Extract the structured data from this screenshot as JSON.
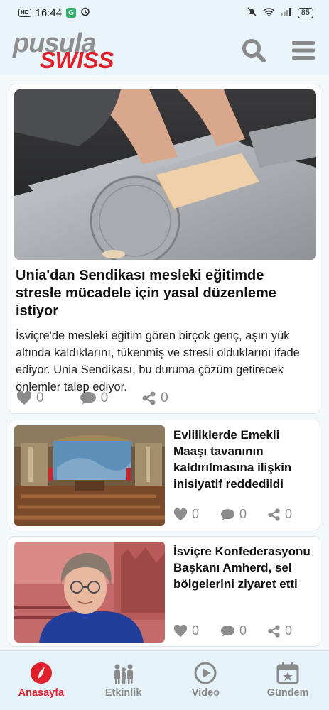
{
  "status_bar": {
    "hd": "HD",
    "time": "16:44",
    "g_badge": "G",
    "battery": "85"
  },
  "brand": {
    "logo_top": "pusula",
    "logo_bottom": "SWISS",
    "accent": "#e0202a",
    "gray": "#8e8e8e"
  },
  "header": {
    "search_icon": "search-icon",
    "menu_icon": "hamburger-menu-icon"
  },
  "articles": [
    {
      "title": "Unia'dan Sendikası mesleki eğitimde stresle mücadele için yasal düzenleme istiyor",
      "summary": "İsviçre'de mesleki eğitim gören birçok genç, aşırı yük altında kaldıklarını, tükenmiş ve stresli olduklarını ifade ediyor. Unia Sendikası, bu duruma çözüm getirecek önlemler talep ediyor.",
      "likes": "0",
      "comments": "0",
      "shares": "0"
    },
    {
      "title": "Evliliklerde Emekli Maaşı tavanının kaldırılmasına ilişkin inisiyatif reddedildi",
      "likes": "0",
      "comments": "0",
      "shares": "0"
    },
    {
      "title": "İsviçre Konfederasyonu Başkanı Amherd, sel bölgelerini ziyaret etti",
      "likes": "0",
      "comments": "0",
      "shares": "0"
    }
  ],
  "bottom_nav": [
    {
      "label": "Anasayfa",
      "icon": "compass-icon",
      "active": true
    },
    {
      "label": "Etkinlik",
      "icon": "people-icon",
      "active": false
    },
    {
      "label": "Video",
      "icon": "play-circle-icon",
      "active": false
    },
    {
      "label": "Gündem",
      "icon": "calendar-star-icon",
      "active": false
    }
  ]
}
